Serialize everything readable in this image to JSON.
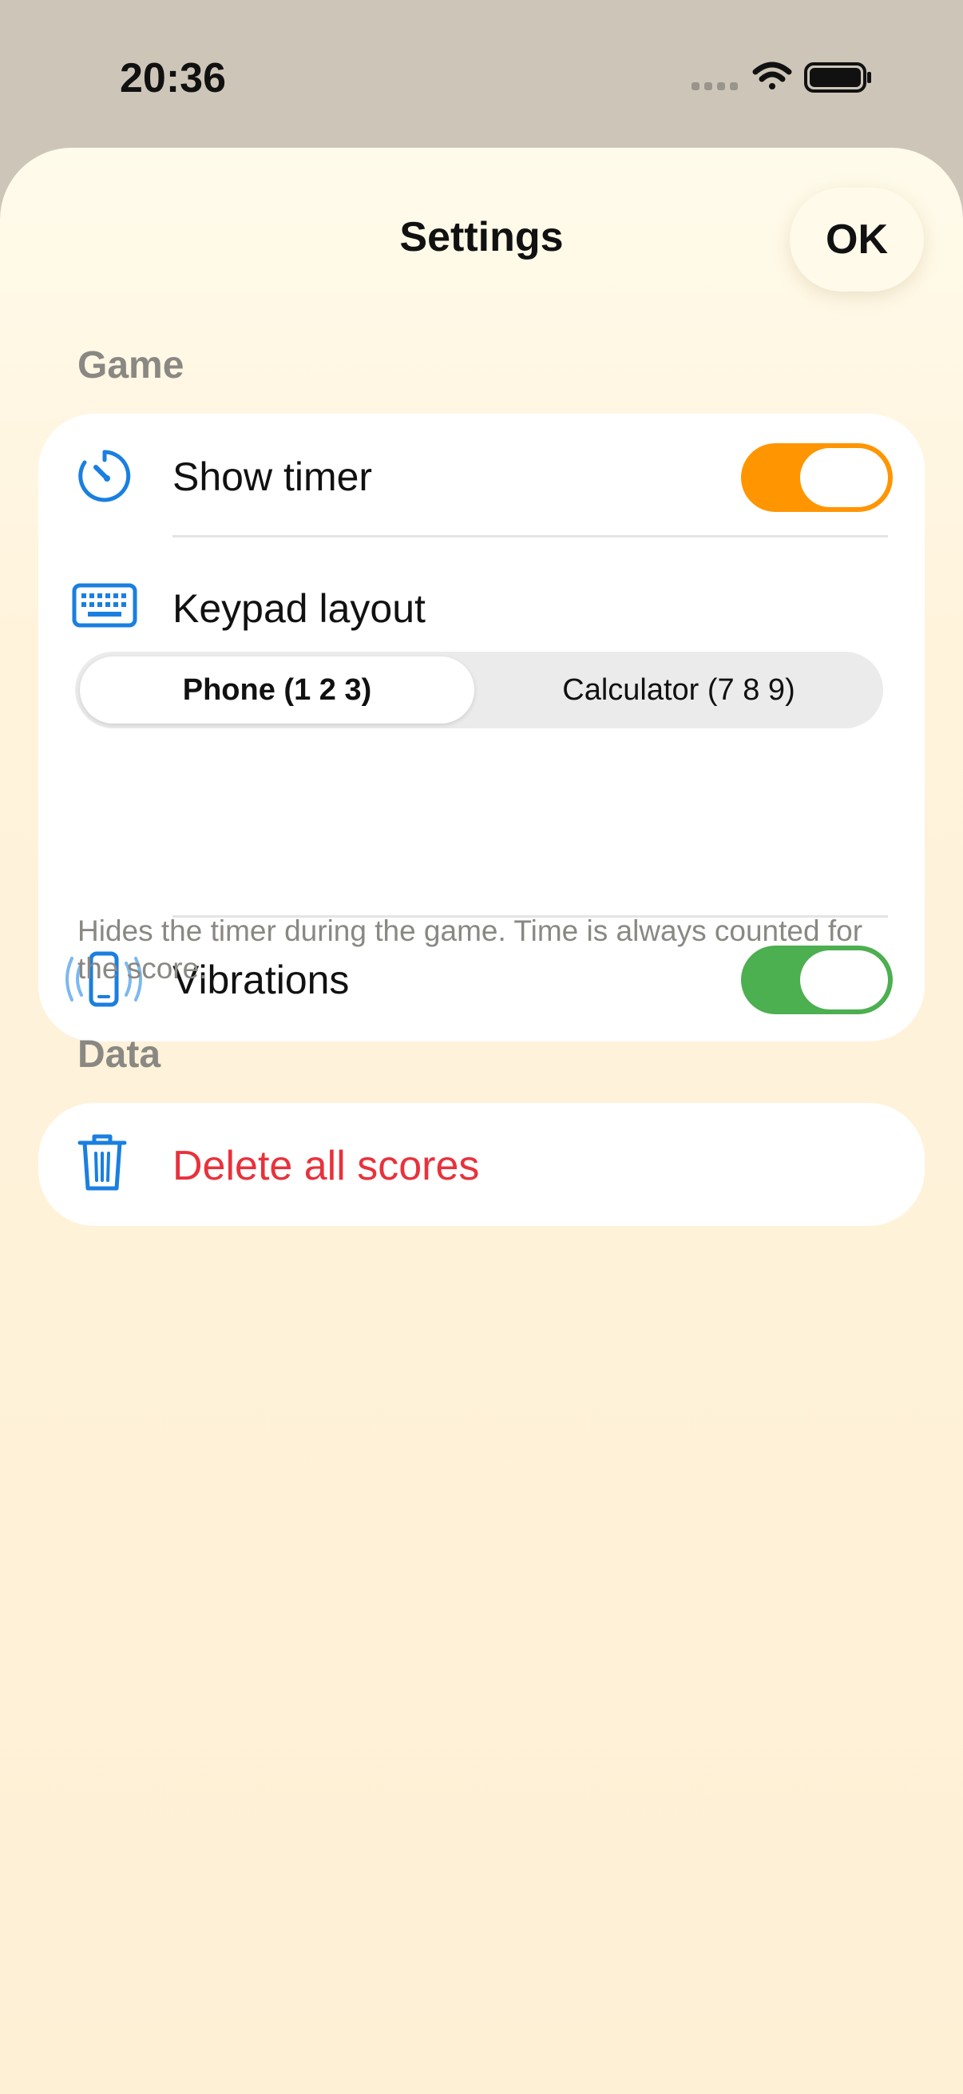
{
  "status_bar": {
    "time": "20:36"
  },
  "header": {
    "title": "Settings",
    "ok_label": "OK"
  },
  "sections": {
    "game": {
      "header": "Game",
      "show_timer": {
        "label": "Show timer",
        "enabled": true,
        "color": "#ff9500",
        "icon": "timer-icon"
      },
      "keypad_layout": {
        "label": "Keypad layout",
        "icon": "keyboard-icon",
        "options": [
          "Phone (1 2 3)",
          "Calculator (7 8 9)"
        ],
        "selected": "Phone (1 2 3)"
      },
      "vibrations": {
        "label": "Vibrations",
        "enabled": true,
        "color": "#4caf50",
        "icon": "phone-vibrate-icon"
      },
      "footnote": "Hides the timer during the game. Time is always counted for the score."
    },
    "data": {
      "header": "Data",
      "delete_scores": {
        "label": "Delete all scores",
        "color": "#e8323c",
        "icon": "trash-icon"
      }
    }
  },
  "colors": {
    "accent_blue": "#1a7fe0",
    "destructive": "#e8323c"
  }
}
